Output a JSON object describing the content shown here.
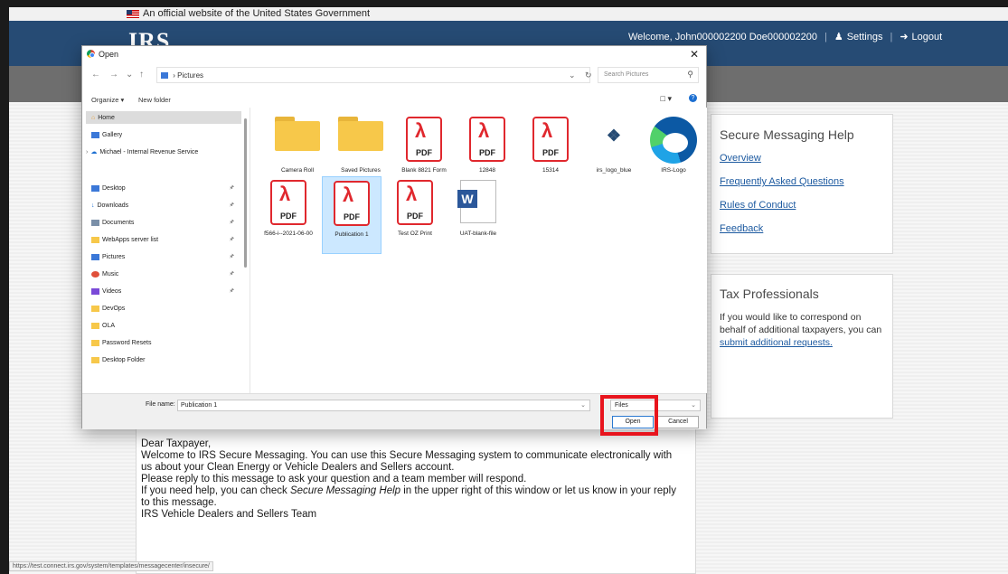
{
  "gov_banner": "An official website of the United States Government",
  "header": {
    "logo": "IRS",
    "welcome": "Welcome, John000002200 Doe000002200",
    "settings": "Settings",
    "logout": "Logout"
  },
  "help_box": {
    "title": "Secure Messaging Help",
    "links": [
      "Overview",
      "Frequently Asked Questions",
      "Rules of Conduct",
      "Feedback"
    ]
  },
  "tax_box": {
    "title": "Tax Professionals",
    "text": "If you would like to correspond on behalf of additional taxpayers, you can",
    "link": "submit additional requests."
  },
  "message": {
    "greeting": "Dear Taxpayer,",
    "line1": "Welcome to IRS Secure Messaging. You can use this Secure Messaging system to communicate electronically with us about your Clean Energy or Vehicle Dealers and Sellers account.",
    "line2": "Please reply to this message to ask your question and a team member will respond.",
    "line3_pre": "If you need help, you can check ",
    "line3_em": "Secure Messaging Help",
    "line3_post": " in the upper right of this window or let us know in your reply to this message.",
    "signature": "IRS Vehicle Dealers and Sellers Team"
  },
  "status_url": "https://test.connect.irs.gov/system/templates/messagecenter/insecure/",
  "dialog": {
    "title": "Open",
    "address": "Pictures",
    "search_placeholder": "Search Pictures",
    "organize": "Organize",
    "new_folder": "New folder",
    "nav": {
      "home": "Home",
      "gallery": "Gallery",
      "onedrive": "Michael - Internal Revenue Service",
      "desktop": "Desktop",
      "downloads": "Downloads",
      "documents": "Documents",
      "webapps": "WebApps server list",
      "pictures": "Pictures",
      "music": "Music",
      "videos": "Videos",
      "devops": "DevOps",
      "ola": "OLA",
      "password_resets": "Password Resets",
      "desktop_folder": "Desktop Folder"
    },
    "files": {
      "camera_roll": "Camera Roll",
      "saved_pictures": "Saved Pictures",
      "blank_8821": "Blank 8821 Form",
      "f12848": "12848",
      "f15314": "15314",
      "irs_logo_blue": "irs_logo_blue",
      "irs_logo": "IRS-Logo",
      "f5566": "f566-i--2021-06-00",
      "publication1": "Publication 1",
      "test_oz": "Test OZ Print",
      "uat_blank": "UAT-blank-file"
    },
    "pdf_label": "PDF",
    "file_name_label": "File name:",
    "file_name_value": "Publication 1",
    "file_type": "Files",
    "open_button": "Open",
    "cancel_button": "Cancel"
  }
}
